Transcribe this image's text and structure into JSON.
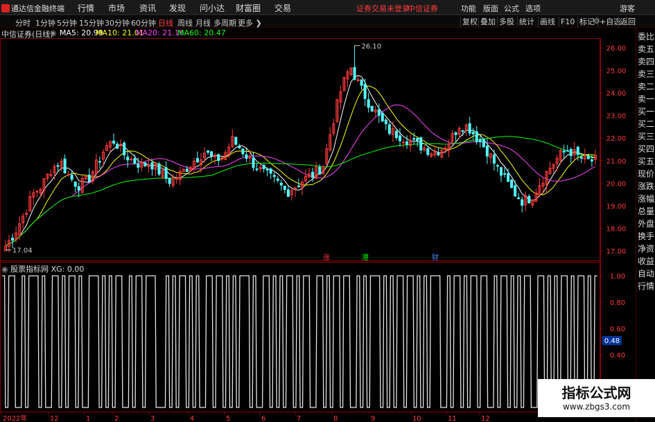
{
  "app": {
    "title": "通达信金融终端"
  },
  "menu": [
    "行情",
    "市场",
    "资讯",
    "发现",
    "问小达",
    "财富圈",
    "交易"
  ],
  "menu_status": [
    "证券交易未登录",
    "中信证券"
  ],
  "menu_right": [
    "功能",
    "版面",
    "公式",
    "选项",
    "游客"
  ],
  "periods": [
    {
      "label": "分时",
      "active": false
    },
    {
      "label": "1分钟",
      "active": false
    },
    {
      "label": "5分钟",
      "active": false
    },
    {
      "label": "15分钟",
      "active": false
    },
    {
      "label": "30分钟",
      "active": false
    },
    {
      "label": "60分钟",
      "active": false
    },
    {
      "label": "日线",
      "active": true
    },
    {
      "label": "周线",
      "active": false
    },
    {
      "label": "月线",
      "active": false
    },
    {
      "label": "多周期",
      "active": false
    },
    {
      "label": "更多 ❯",
      "active": false
    }
  ],
  "toolbar": [
    "复权",
    "叠加",
    "多股",
    "统计",
    "画线",
    "F10",
    "标记",
    "+自选",
    "返回"
  ],
  "stock": {
    "title": "中信证券(日线)"
  },
  "ma": [
    {
      "label": "MA5: 20.99",
      "color": "#ffffff"
    },
    {
      "label": "MA10: 21.01",
      "color": "#ffff00"
    },
    {
      "label": "MA20: 21.16",
      "color": "#ff44ff"
    },
    {
      "label": "MA60: 20.47",
      "color": "#00ff00"
    }
  ],
  "price_annotations": {
    "high": "26.10",
    "low": "17.04"
  },
  "event_markers": [
    {
      "label": "涨",
      "color": "#ff3333"
    },
    {
      "label": "港",
      "color": "#00ff00"
    },
    {
      "label": "财",
      "color": "#4488ff"
    }
  ],
  "sub_indicator": {
    "name": "股票指标网",
    "value": "XG: 0.00"
  },
  "right_panel": [
    "委比",
    "卖五",
    "卖四",
    "卖三",
    "卖二",
    "卖一",
    "买一",
    "买二",
    "买三",
    "买四",
    "买五",
    "现价",
    "涨跌",
    "涨幅",
    "总量",
    "外盘",
    "换手",
    "净资",
    "收益",
    "自动",
    "行情"
  ],
  "watermark": {
    "title": "指标公式网",
    "url": "www.zbgs3.com"
  },
  "colors": {
    "up": "#ff3b3b",
    "down": "#54ffff",
    "axis": "#8b0000",
    "bg": "#000000"
  },
  "chart_data": [
    {
      "type": "candlestick",
      "ylim": [
        16.6,
        26.4
      ],
      "y_ticks": [
        "26.00",
        "25.00",
        "24.00",
        "23.00",
        "22.00",
        "21.00",
        "20.00",
        "19.00",
        "18.00",
        "17.00"
      ],
      "x_ticks": [
        "2022年",
        "12",
        "1",
        "2",
        "3",
        "4",
        "5",
        "6",
        "7",
        "8",
        "9",
        "10",
        "11",
        "12"
      ],
      "close_path": [
        17.2,
        17.8,
        18.6,
        19.5,
        19.9,
        20.6,
        21.0,
        20.3,
        19.9,
        20.1,
        20.8,
        21.6,
        21.9,
        21.3,
        21.0,
        20.8,
        20.9,
        20.5,
        20.1,
        20.3,
        20.7,
        21.1,
        21.4,
        21.0,
        21.2,
        21.9,
        21.5,
        21.0,
        20.6,
        20.3,
        20.0,
        19.6,
        19.9,
        20.2,
        20.4,
        20.8,
        22.6,
        24.2,
        25.2,
        24.3,
        23.6,
        23.0,
        22.4,
        22.2,
        22.0,
        21.8,
        21.6,
        21.4,
        21.5,
        21.9,
        22.6,
        22.5,
        22.0,
        21.5,
        20.8,
        20.2,
        19.6,
        19.2,
        19.4,
        20.1,
        20.7,
        21.2,
        21.5,
        21.2,
        21.0,
        21.0
      ],
      "series": [
        {
          "name": "MA5",
          "value": 20.99
        },
        {
          "name": "MA10",
          "value": 21.01
        },
        {
          "name": "MA20",
          "value": 21.16
        },
        {
          "name": "MA60",
          "value": 20.47
        }
      ],
      "annotations": [
        {
          "label": "26.10",
          "value": 26.1
        },
        {
          "label": "17.04",
          "value": 17.04
        }
      ]
    },
    {
      "type": "line",
      "name": "XG",
      "ylim": [
        0,
        1
      ],
      "y_ticks": [
        "1.00",
        "0.80",
        "0.60",
        "0.40"
      ],
      "current_value": "0.48",
      "signal": [
        1,
        0,
        1,
        1,
        0,
        0,
        1,
        0,
        1,
        1,
        1,
        0,
        1,
        0,
        0,
        1,
        1,
        0,
        1,
        0,
        1,
        1,
        0,
        1,
        0,
        0,
        1,
        1,
        1,
        0,
        1,
        0,
        1,
        0,
        1,
        1,
        0,
        0,
        1,
        0,
        1,
        1,
        0,
        1,
        1,
        1,
        0,
        0,
        0,
        1,
        0,
        1,
        0,
        1,
        1,
        0,
        1,
        0,
        1,
        0,
        0,
        1,
        1,
        0,
        1,
        1,
        0,
        1,
        0,
        1,
        0,
        1,
        1,
        1,
        0,
        1,
        0,
        0,
        1,
        1,
        0,
        1,
        0,
        1,
        0,
        1,
        1,
        0,
        1,
        0,
        1,
        1,
        0,
        0,
        1,
        1,
        0,
        1,
        0,
        1,
        1,
        0,
        1,
        1,
        0,
        0,
        1,
        0,
        1,
        0,
        1,
        1,
        1,
        0,
        1,
        0,
        1,
        0,
        1,
        1,
        0,
        1,
        1,
        0,
        1,
        0,
        1,
        0,
        1,
        1,
        1,
        0,
        0,
        1,
        0,
        1,
        1,
        0,
        1,
        0,
        1,
        1,
        0,
        1,
        1,
        0,
        0,
        1,
        0,
        1,
        1,
        0,
        1,
        0,
        1,
        0,
        1,
        1,
        0,
        0,
        1,
        1,
        0,
        1,
        0,
        1,
        0,
        1,
        1,
        0,
        1,
        0,
        1,
        1,
        0,
        1,
        0,
        1
      ]
    }
  ]
}
